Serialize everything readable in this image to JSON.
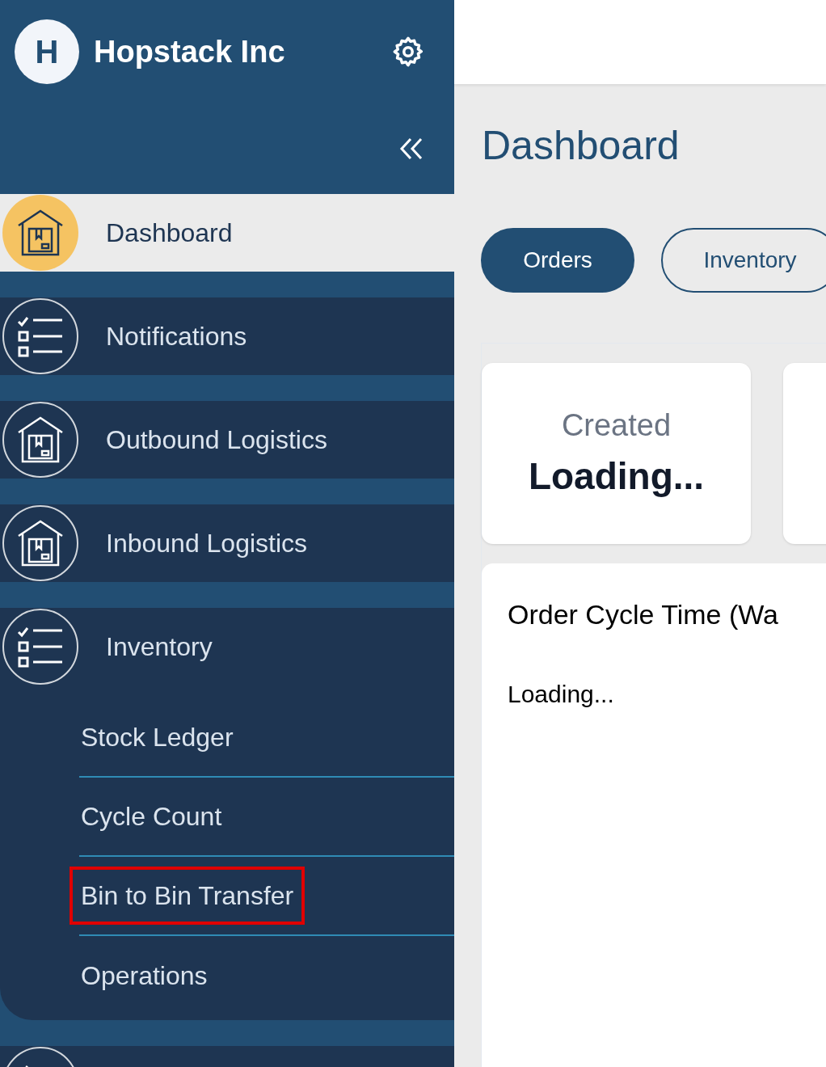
{
  "brand": {
    "logo_letter": "H",
    "name": "Hopstack Inc"
  },
  "nav": [
    {
      "label": "Dashboard",
      "kind": "warehouse",
      "selected": true,
      "expanded": false
    },
    {
      "label": "Notifications",
      "kind": "checklist",
      "selected": false,
      "expanded": false
    },
    {
      "label": "Outbound Logistics",
      "kind": "warehouse",
      "selected": false,
      "expanded": false
    },
    {
      "label": "Inbound Logistics",
      "kind": "warehouse",
      "selected": false,
      "expanded": false
    },
    {
      "label": "Inventory",
      "kind": "checklist",
      "selected": false,
      "expanded": true,
      "children": [
        {
          "label": "Stock Ledger",
          "highlighted": false
        },
        {
          "label": "Cycle Count",
          "highlighted": false
        },
        {
          "label": "Bin to Bin Transfer",
          "highlighted": true
        },
        {
          "label": "Operations",
          "highlighted": false
        }
      ]
    },
    {
      "kind": "checklist",
      "selected": false,
      "expanded": false
    }
  ],
  "page_title": "Dashboard",
  "tabs": [
    {
      "label": "Orders",
      "selected": true
    },
    {
      "label": "Inventory",
      "selected": false
    }
  ],
  "stat_cards": [
    {
      "kind": "stat",
      "title": "Created",
      "value": "Loading..."
    },
    {
      "kind": "stat"
    }
  ],
  "chart_card": {
    "title": "Order Cycle Time (Wa",
    "status": "Loading..."
  }
}
